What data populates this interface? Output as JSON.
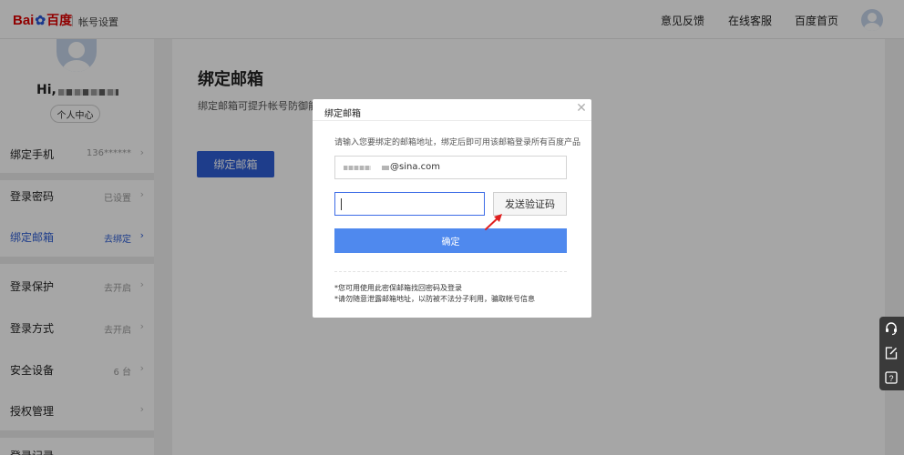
{
  "header": {
    "logo_bai": "Bai",
    "logo_du": "百度",
    "page_name": "帐号设置",
    "nav": [
      "意见反馈",
      "在线客服",
      "百度首页"
    ]
  },
  "sidebar": {
    "greeting": "Hi,",
    "profile_button": "个人中心",
    "items": [
      {
        "label": "绑定手机",
        "value": "136******"
      },
      {
        "label": "登录密码",
        "value": "已设置"
      },
      {
        "label": "绑定邮箱",
        "value": "去绑定"
      },
      {
        "label": "登录保护",
        "value": "去开启"
      },
      {
        "label": "登录方式",
        "value": "去开启"
      },
      {
        "label": "安全设备",
        "value": "6 台"
      },
      {
        "label": "授权管理",
        "value": ""
      }
    ],
    "partial_item": "登录记录"
  },
  "main": {
    "title": "绑定邮箱",
    "description": "绑定邮箱可提升帐号防御能 邮箱可用来登录所有百度产",
    "button": "绑定邮箱"
  },
  "modal": {
    "title": "绑定邮箱",
    "hint": "请输入您要绑定的邮箱地址，绑定后即可用该邮箱登录所有百度产品",
    "email_suffix": "@sina.com",
    "code_value": "",
    "send_code": "发送验证码",
    "confirm": "确定",
    "note1": "*您可用使用此密保邮箱找回密码及登录",
    "note2": "*请勿随意泄露邮箱地址，以防被不法分子利用，骗取帐号信息"
  },
  "colors": {
    "brand_blue": "#2f5ed6",
    "confirm_blue": "#4f89ee",
    "logo_red": "#de0000",
    "active_link": "#2f5ed6"
  },
  "icons": [
    "close-icon",
    "chevron-right-icon",
    "headset-icon",
    "edit-icon",
    "help-icon",
    "arrow-annotation-icon"
  ]
}
